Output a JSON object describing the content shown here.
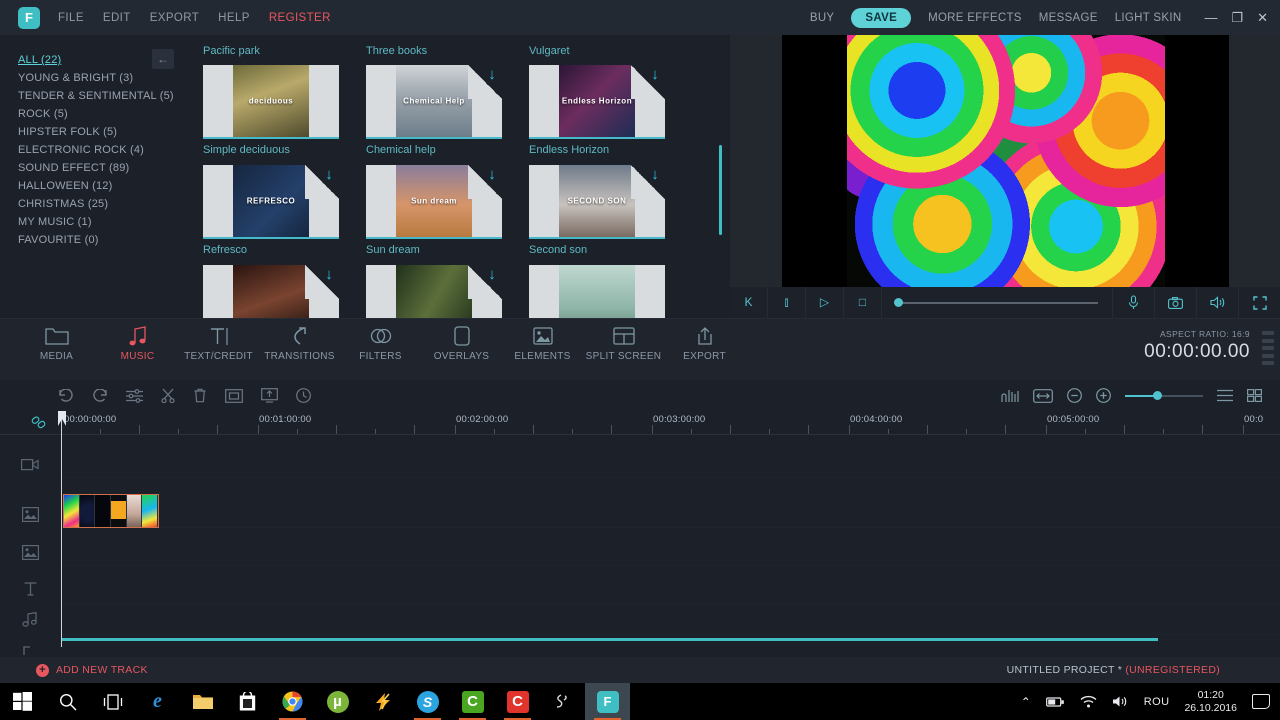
{
  "app": {
    "logo_letter": "F",
    "menu_left": [
      {
        "label": "FILE",
        "kind": "normal"
      },
      {
        "label": "EDIT",
        "kind": "normal"
      },
      {
        "label": "EXPORT",
        "kind": "normal"
      },
      {
        "label": "HELP",
        "kind": "normal"
      },
      {
        "label": "REGISTER",
        "kind": "register"
      }
    ],
    "menu_right": {
      "buy": "BUY",
      "save": "SAVE",
      "more_effects": "MORE EFFECTS",
      "message": "MESSAGE",
      "light_skin": "LIGHT SKIN",
      "minimize": "—",
      "maximize": "❐",
      "close": "✕"
    },
    "accent_teal": "#3fbfc4",
    "accent_red": "#e8565f"
  },
  "categories": {
    "collapse_glyph": "←",
    "items": [
      {
        "label": "ALL (22)",
        "active": true
      },
      {
        "label": "YOUNG & BRIGHT (3)",
        "active": false
      },
      {
        "label": "TENDER & SENTIMENTAL (5)",
        "active": false
      },
      {
        "label": "ROCK (5)",
        "active": false
      },
      {
        "label": "HIPSTER FOLK (5)",
        "active": false
      },
      {
        "label": "ELECTRONIC ROCK (4)",
        "active": false
      },
      {
        "label": "SOUND EFFECT (89)",
        "active": false
      },
      {
        "label": "HALLOWEEN (12)",
        "active": false
      },
      {
        "label": "CHRISTMAS (25)",
        "active": false
      },
      {
        "label": "MY MUSIC (1)",
        "active": false
      },
      {
        "label": "FAVOURITE (0)",
        "active": false
      }
    ]
  },
  "music_grid": {
    "group_titles": [
      "Pacific park",
      "Three books",
      "Vulgaret"
    ],
    "rows": [
      [
        {
          "label": "Simple deciduous",
          "art_text": "deciduous",
          "downloadable": false
        },
        {
          "label": "Chemical help",
          "art_text": "Chemical Help",
          "downloadable": true
        },
        {
          "label": "Endless Horizon",
          "art_text": "Endless Horizon",
          "downloadable": true
        }
      ],
      [
        {
          "label": "Refresco",
          "art_text": "REFRESCO",
          "downloadable": true
        },
        {
          "label": "Sun dream",
          "art_text": "Sun dream",
          "downloadable": true
        },
        {
          "label": "Second son",
          "art_text": "SECOND SON",
          "downloadable": true
        }
      ],
      [
        {
          "label": "",
          "art_text": "",
          "downloadable": true
        },
        {
          "label": "",
          "art_text": "",
          "downloadable": true
        },
        {
          "label": "",
          "art_text": "",
          "downloadable": false
        }
      ]
    ],
    "download_glyph": "↓"
  },
  "preview": {
    "controls": {
      "prev_frame": "K",
      "next_frame": "⫾",
      "play": "▷",
      "stop": "□",
      "mic": "mic-icon",
      "snapshot": "camera-icon",
      "volume": "speaker-icon",
      "fullscreen": "fullscreen-icon"
    }
  },
  "tool_tabs": {
    "items": [
      {
        "label": "MEDIA",
        "icon": "folder-icon",
        "active": false
      },
      {
        "label": "MUSIC",
        "icon": "music-note-icon",
        "active": true
      },
      {
        "label": "TEXT/CREDIT",
        "icon": "text-icon",
        "active": false
      },
      {
        "label": "TRANSITIONS",
        "icon": "transitions-icon",
        "active": false
      },
      {
        "label": "FILTERS",
        "icon": "filters-icon",
        "active": false
      },
      {
        "label": "OVERLAYS",
        "icon": "overlays-icon",
        "active": false
      },
      {
        "label": "ELEMENTS",
        "icon": "elements-icon",
        "active": false
      },
      {
        "label": "SPLIT SCREEN",
        "icon": "split-screen-icon",
        "active": false
      },
      {
        "label": "EXPORT",
        "icon": "export-icon",
        "active": false
      }
    ],
    "aspect_ratio": "ASPECT RATIO: 16:9",
    "timecode": "00:00:00.00"
  },
  "timeline_toolbar": {
    "left_icons": [
      "undo-icon",
      "redo-icon",
      "settings-sliders-icon",
      "cut-scissors-icon",
      "delete-trash-icon",
      "crop-icon",
      "green-screen-icon",
      "duration-clock-icon"
    ],
    "right_icons": [
      "audio-detach-icon",
      "fit-timeline-icon",
      "zoom-out-icon",
      "zoom-in-icon"
    ],
    "list_view_icon": "list-view-icon",
    "grid_view_icon": "grid-view-icon"
  },
  "timeline": {
    "link_icon": "link-icon",
    "ticks": [
      "00:00:00:00",
      "00:01:00:00",
      "00:02:00:00",
      "00:03:00:00",
      "00:04:00:00",
      "00:05:00:00",
      "00:0"
    ],
    "tracks": [
      {
        "icon": "video-camera-icon",
        "name": "video-track"
      },
      {
        "icon": "image-track-icon",
        "name": "image-track-1"
      },
      {
        "icon": "image-track-icon",
        "name": "image-track-2"
      },
      {
        "icon": "text-track-icon",
        "name": "text-track"
      },
      {
        "icon": "audio-note-icon",
        "name": "audio-track"
      },
      {
        "icon": "voice-track-icon",
        "name": "voiceover-track"
      }
    ]
  },
  "status_bar": {
    "add_new_track": "ADD NEW TRACK",
    "project_name": "UNTITLED PROJECT *",
    "registration": "(UNREGISTERED)"
  },
  "taskbar": {
    "items": [
      {
        "name": "start-button",
        "icon": "windows-logo-icon",
        "label": "",
        "open": false
      },
      {
        "name": "search-button",
        "icon": "search-icon",
        "label": "",
        "open": false
      },
      {
        "name": "task-view-button",
        "icon": "task-view-icon",
        "label": "",
        "open": false
      },
      {
        "name": "edge-button",
        "icon": "edge-icon",
        "label": "e",
        "open": false
      },
      {
        "name": "file-explorer-button",
        "icon": "folder-icon",
        "label": "",
        "open": false
      },
      {
        "name": "store-button",
        "icon": "store-icon",
        "label": "",
        "open": false
      },
      {
        "name": "chrome-button",
        "icon": "chrome-icon",
        "label": "",
        "open": true
      },
      {
        "name": "utorrent-button",
        "icon": "utorrent-icon",
        "label": "µ",
        "open": false
      },
      {
        "name": "lightning-app-button",
        "icon": "lightning-icon",
        "label": "",
        "open": false
      },
      {
        "name": "skype-button",
        "icon": "skype-icon",
        "label": "S",
        "open": true
      },
      {
        "name": "camtasia-button",
        "icon": "camtasia-icon",
        "label": "C",
        "open": true
      },
      {
        "name": "c-app-button",
        "icon": "c-app-icon",
        "label": "C",
        "open": true
      },
      {
        "name": "swish-app-button",
        "icon": "swish-icon",
        "label": "",
        "open": false
      },
      {
        "name": "filmora-button",
        "icon": "filmora-icon",
        "label": "F",
        "open": true
      }
    ],
    "tray": {
      "chevron": "⌃",
      "battery_icon": "battery-icon",
      "wifi_icon": "wifi-icon",
      "volume_icon": "volume-icon",
      "language": "ROU",
      "time": "01:20",
      "date": "26.10.2016",
      "notifications_icon": "notification-center-icon"
    }
  }
}
